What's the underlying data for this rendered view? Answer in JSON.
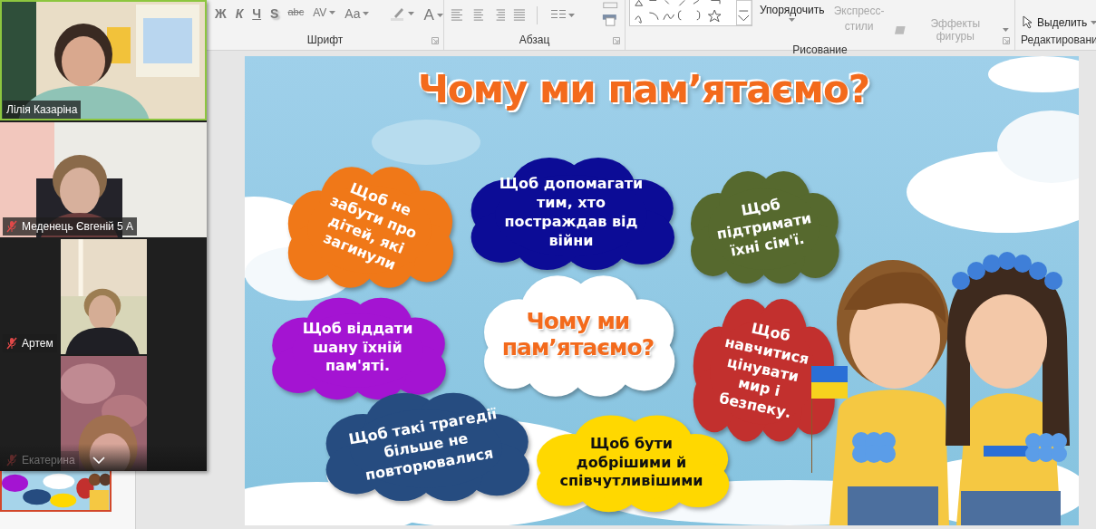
{
  "ribbon": {
    "font_group": {
      "label": "Шрифт",
      "buttons": [
        {
          "label": "Ж",
          "kind": "bold",
          "dropdown": false
        },
        {
          "label": "К",
          "kind": "italic",
          "dropdown": false
        },
        {
          "label": "Ч",
          "kind": "underline",
          "dropdown": false
        },
        {
          "label": "S",
          "kind": "shadow",
          "dropdown": false
        },
        {
          "label": "abc",
          "kind": "strike",
          "dropdown": false
        },
        {
          "label": "AV",
          "kind": "spacing",
          "dropdown": true
        },
        {
          "label": "Aa",
          "kind": "case",
          "dropdown": true
        },
        {
          "label": "A",
          "kind": "color",
          "dropdown": true
        }
      ]
    },
    "paragraph_group": {
      "label": "Абзац"
    },
    "drawing_group": {
      "label": "Рисование",
      "arrange": {
        "label": "Упорядочить",
        "disabled": false
      },
      "quick_styles": {
        "label": "Экспресс-стили",
        "disabled": true
      },
      "shape_effects": {
        "label": "Эффекты фигуры",
        "disabled": true
      }
    },
    "editing_group": {
      "label": "Редактировани",
      "select": {
        "label": "Выделить"
      }
    }
  },
  "meeting": {
    "participants": [
      {
        "name": "Лілія Казаріна",
        "muted": false,
        "speaking": true
      },
      {
        "name": "Меденець Євгеній 5 А",
        "muted": true,
        "speaking": false
      },
      {
        "name": "Артем",
        "muted": true,
        "speaking": false
      },
      {
        "name": "Екатерина",
        "muted": true,
        "speaking": false
      }
    ]
  },
  "slide": {
    "title": "Чому ми пам’ятаємо?",
    "clouds": [
      {
        "kind": "reason",
        "text": "Щоб не забути про дітей, які загинули",
        "color": "#f07818"
      },
      {
        "kind": "reason",
        "text": "Щоб допомагати тим, хто постраждав від війни",
        "color": "#0c0c96"
      },
      {
        "kind": "reason",
        "text": "Щоб підтримати їхні сім'ї.",
        "color": "#56692e"
      },
      {
        "kind": "reason",
        "text": "Щоб віддати шану їхній пам'яті.",
        "color": "#a414d2"
      },
      {
        "kind": "title",
        "text": "Чому ми пам’ятаємо?",
        "color": "#ffffff"
      },
      {
        "kind": "reason",
        "text": "Щоб навчитися цінувати мир і безпеку.",
        "color": "#c2302e"
      },
      {
        "kind": "reason",
        "text": "Щоб такі трагедії більше не повторювалися",
        "color": "#264c80"
      },
      {
        "kind": "reason",
        "text": "Щоб бути добрішими й співчутливішими",
        "color": "#ffd800"
      }
    ]
  }
}
